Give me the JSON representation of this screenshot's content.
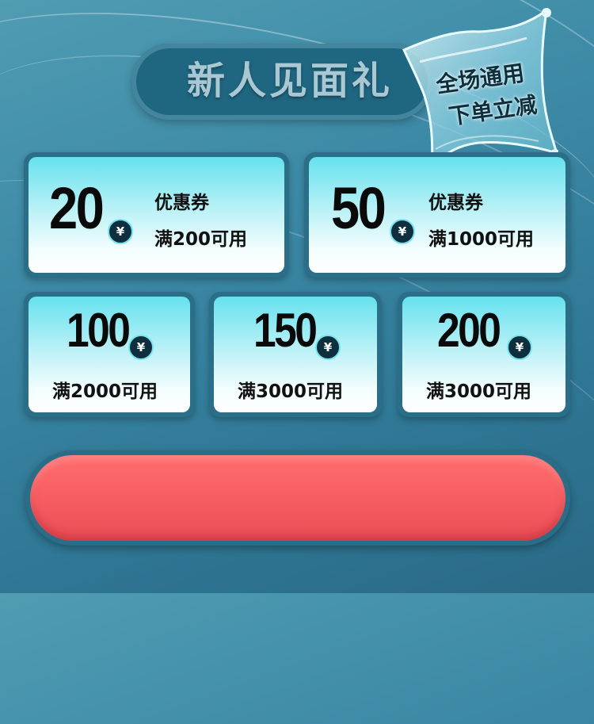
{
  "header": {
    "title": "新人见面礼",
    "badge_line1": "全场通用",
    "badge_line2": "下单立减"
  },
  "currency_symbol": "¥",
  "coupons_large": [
    {
      "amount": "20",
      "type": "优惠券",
      "condition": "满200可用"
    },
    {
      "amount": "50",
      "type": "优惠券",
      "condition": "满1000可用"
    }
  ],
  "coupons_small": [
    {
      "amount": "100",
      "condition": "满2000可用"
    },
    {
      "amount": "150",
      "condition": "满3000可用"
    },
    {
      "amount": "200",
      "condition": "满3000可用"
    }
  ],
  "cta": {
    "label": ""
  },
  "colors": {
    "background": "#3d8aa6",
    "title_pill": "#1f6680",
    "card_top": "#66e1ef",
    "card_bottom": "#ffffff",
    "cta": "#f45a5f"
  }
}
